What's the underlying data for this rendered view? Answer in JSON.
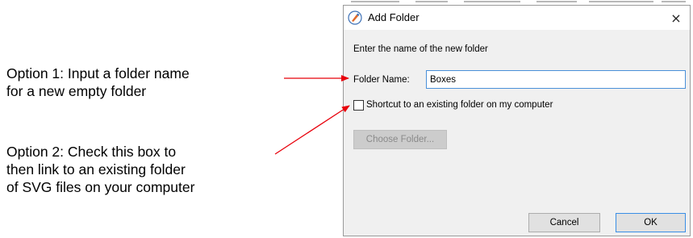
{
  "annotations": {
    "option1": "Option 1: Input a folder name\nfor a new empty folder",
    "option2": "Option 2: Check this box to\nthen link to an existing folder\nof SVG files on your computer"
  },
  "dialog": {
    "title": "Add Folder",
    "close_symbol": "×",
    "prompt": "Enter the name of the new folder",
    "folder_name_label": "Folder Name:",
    "folder_name_value": "Boxes",
    "shortcut_checked": false,
    "shortcut_label": "Shortcut to an existing folder on my computer",
    "choose_folder_label": "Choose Folder...",
    "cancel_label": "Cancel",
    "ok_label": "OK"
  },
  "icons": {
    "app": "pen-nib-icon",
    "close": "close-icon",
    "arrow_color": "#e8000b"
  }
}
